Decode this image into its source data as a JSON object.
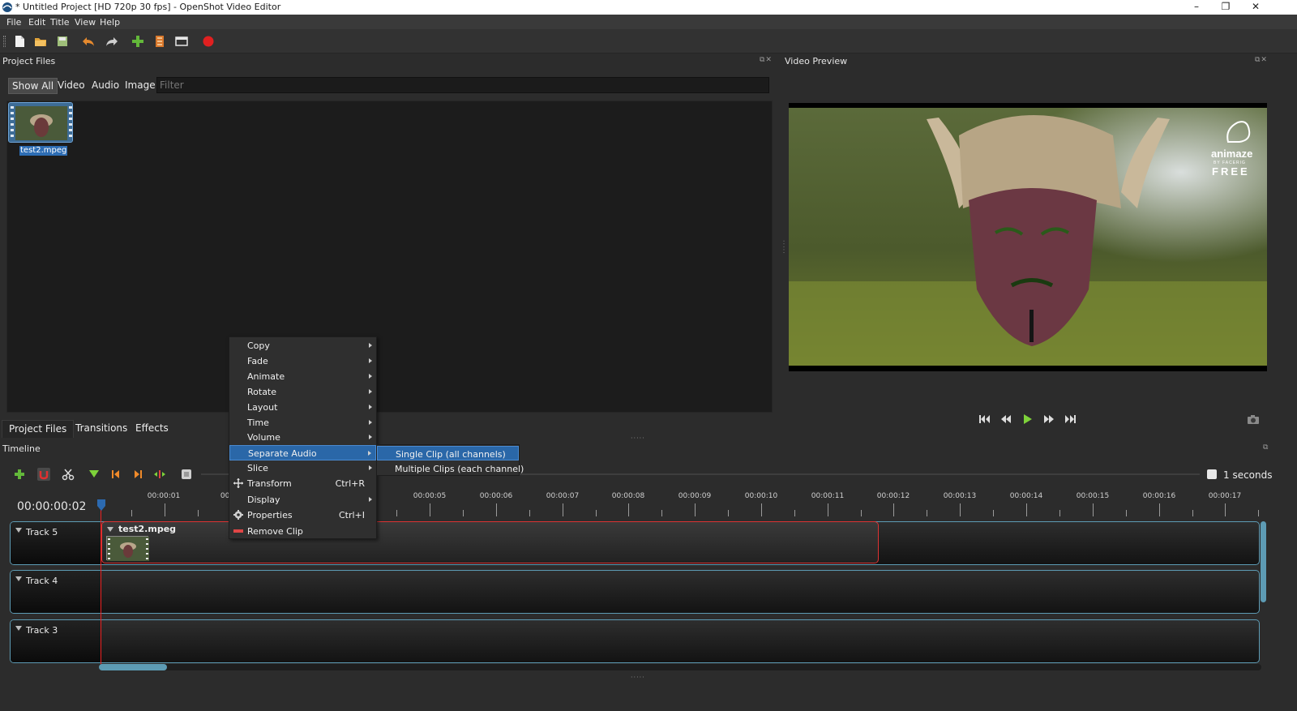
{
  "window": {
    "title": "* Untitled Project [HD 720p 30 fps] - OpenShot Video Editor",
    "minimize": "–",
    "maximize": "❐",
    "close": "✕"
  },
  "menubar": [
    "File",
    "Edit",
    "Title",
    "View",
    "Help"
  ],
  "toolbar": {
    "icons": [
      "new-project-icon",
      "open-project-icon",
      "save-project-icon",
      "undo-icon",
      "redo-icon",
      "import-files-icon",
      "choose-profile-icon",
      "fullscreen-icon",
      "export-video-icon"
    ]
  },
  "project_files": {
    "panel_title": "Project Files",
    "filters": [
      "Show All",
      "Video",
      "Audio",
      "Image"
    ],
    "filter_placeholder": "Filter",
    "files": [
      {
        "name": "test2.mpeg"
      }
    ]
  },
  "bottom_tabs": [
    "Project Files",
    "Transitions",
    "Effects"
  ],
  "video_preview": {
    "panel_title": "Video Preview",
    "watermark_line1": "animaze",
    "watermark_line2": "FREE",
    "watermark_small": "BY FACERIG",
    "controls": [
      "jump-start-icon",
      "rewind-icon",
      "play-icon",
      "fast-forward-icon",
      "jump-end-icon"
    ]
  },
  "timeline": {
    "panel_title": "Timeline",
    "timecode": "00:00:00:02",
    "zoom_label": "1 seconds",
    "ruler_labels": [
      "00:00:01",
      "00:0",
      "00:00:05",
      "00:00:06",
      "00:00:07",
      "00:00:08",
      "00:00:09",
      "00:00:10",
      "00:00:11",
      "00:00:12",
      "00:00:13",
      "00:00:14",
      "00:00:15",
      "00:00:16",
      "00:00:17"
    ],
    "tracks": [
      "Track 5",
      "Track 4",
      "Track 3"
    ],
    "clip_name": "test2.mpeg"
  },
  "context_menu": {
    "items": [
      {
        "label": "Copy",
        "submenu": true
      },
      {
        "label": "Fade",
        "submenu": true
      },
      {
        "label": "Animate",
        "submenu": true
      },
      {
        "label": "Rotate",
        "submenu": true
      },
      {
        "label": "Layout",
        "submenu": true
      },
      {
        "label": "Time",
        "submenu": true
      },
      {
        "label": "Volume",
        "submenu": true
      },
      {
        "label": "Separate Audio",
        "submenu": true
      },
      {
        "label": "Slice",
        "submenu": true
      },
      {
        "label": "Transform",
        "shortcut": "Ctrl+R"
      },
      {
        "label": "Display",
        "submenu": true
      },
      {
        "label": "Properties",
        "shortcut": "Ctrl+I"
      },
      {
        "label": "Remove Clip"
      }
    ],
    "highlighted": "Separate Audio",
    "submenu": [
      "Single Clip (all channels)",
      "Multiple Clips (each channel)"
    ]
  },
  "colors": {
    "highlight": "#2a67a8",
    "track_border": "#5d9bb4",
    "clip_border": "#dd3333",
    "playhead": "#ee2222"
  }
}
